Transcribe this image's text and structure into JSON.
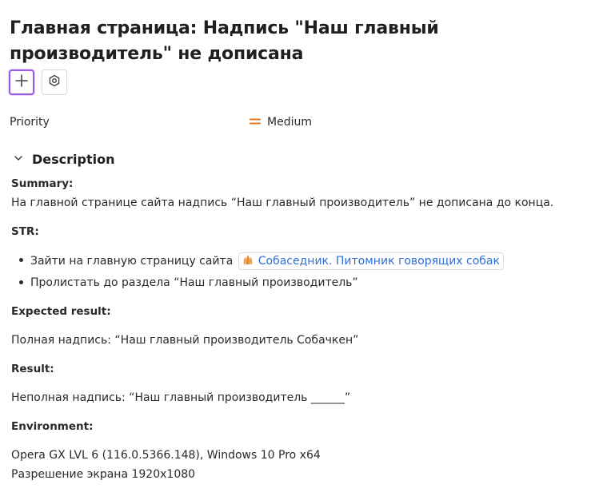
{
  "issue": {
    "title": "Главная страница: Надпись \"Наш главный производитель\" не дописана"
  },
  "toolbar": {
    "add_icon": "plus-icon",
    "settings_icon": "hexagon-settings-icon"
  },
  "properties": {
    "priority_label": "Priority",
    "priority_value": "Medium",
    "priority_icon": "equals-icon",
    "priority_color": "#e07b24"
  },
  "description": {
    "section_title": "Description",
    "summary_heading": "Summary:",
    "summary_text": "На главной странице сайта надпись “Наш главный производитель” не дописана до конца.",
    "str_heading": "STR:",
    "steps": [
      {
        "text": "Зайти на главную страницу сайта",
        "link_text": "Собаседник. Питомник говорящих собак",
        "link_icon": "paws-icon"
      },
      {
        "text": "Пролистать до раздела “Наш главный производитель”"
      }
    ],
    "expected_heading": "Expected result:",
    "expected_text": "Полная надпись: “Наш главный производитель Собачкен”",
    "result_heading": "Result:",
    "result_text": "Неполная надпись: “Наш главный производитель ______”",
    "environment_heading": "Environment:",
    "environment_lines": [
      "Opera GX LVL 6 (116.0.5366.148), Windows 10 Pro x64",
      "Разрешение экрана 1920x1080"
    ]
  },
  "colors": {
    "accent_border": "#9b59e8",
    "link": "#2f6fd6"
  }
}
